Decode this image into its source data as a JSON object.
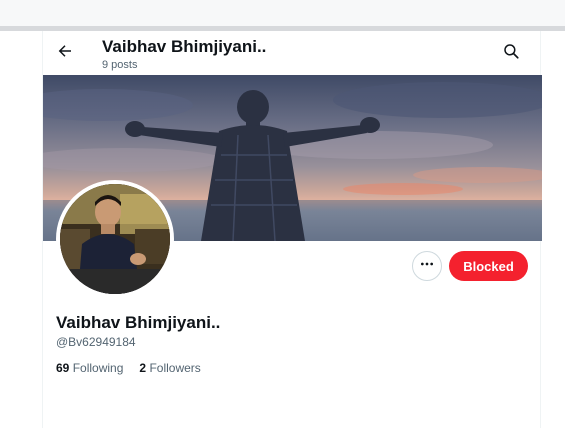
{
  "header": {
    "title": "Vaibhav Bhimjiyani..",
    "subtitle": "9 posts"
  },
  "profile": {
    "display_name": "Vaibhav Bhimjiyani..",
    "handle": "@Bv62949184",
    "blocked_label": "Blocked",
    "following_count": "69",
    "following_label": "Following",
    "followers_count": "2",
    "followers_label": "Followers"
  },
  "icons": {
    "back": "arrow-left-icon",
    "search": "search-icon",
    "more": "more-horizontal-icon"
  },
  "colors": {
    "blocked": "#f4212e",
    "text_primary": "#0f1419",
    "text_secondary": "#536471"
  }
}
